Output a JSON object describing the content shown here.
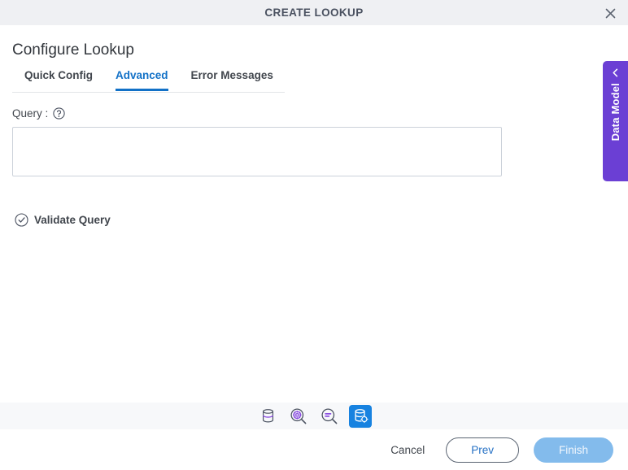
{
  "window": {
    "title": "CREATE LOOKUP",
    "close_icon": "close-icon"
  },
  "page": {
    "title": "Configure Lookup"
  },
  "tabs": [
    {
      "label": "Quick Config",
      "active": false
    },
    {
      "label": "Advanced",
      "active": true
    },
    {
      "label": "Error Messages",
      "active": false
    }
  ],
  "query_field": {
    "label": "Query :",
    "help_icon": "help-circle-icon",
    "value": "",
    "placeholder": ""
  },
  "validate": {
    "label": "Validate Query",
    "icon": "check-circle-icon"
  },
  "side_panel": {
    "label": "Data Model",
    "chevron_icon": "chevron-left-icon",
    "color": "#6b3fd4"
  },
  "icon_toolbar": [
    {
      "name": "database-icon",
      "active": false
    },
    {
      "name": "search-gear-icon",
      "active": false
    },
    {
      "name": "search-list-icon",
      "active": false
    },
    {
      "name": "database-gear-icon",
      "active": true
    }
  ],
  "footer": {
    "cancel_label": "Cancel",
    "prev_label": "Prev",
    "finish_label": "Finish"
  },
  "colors": {
    "accent_blue": "#1271c7",
    "active_icon_blue": "#1782e0",
    "purple": "#6b3fd4",
    "primary_button": "#83bbec"
  }
}
